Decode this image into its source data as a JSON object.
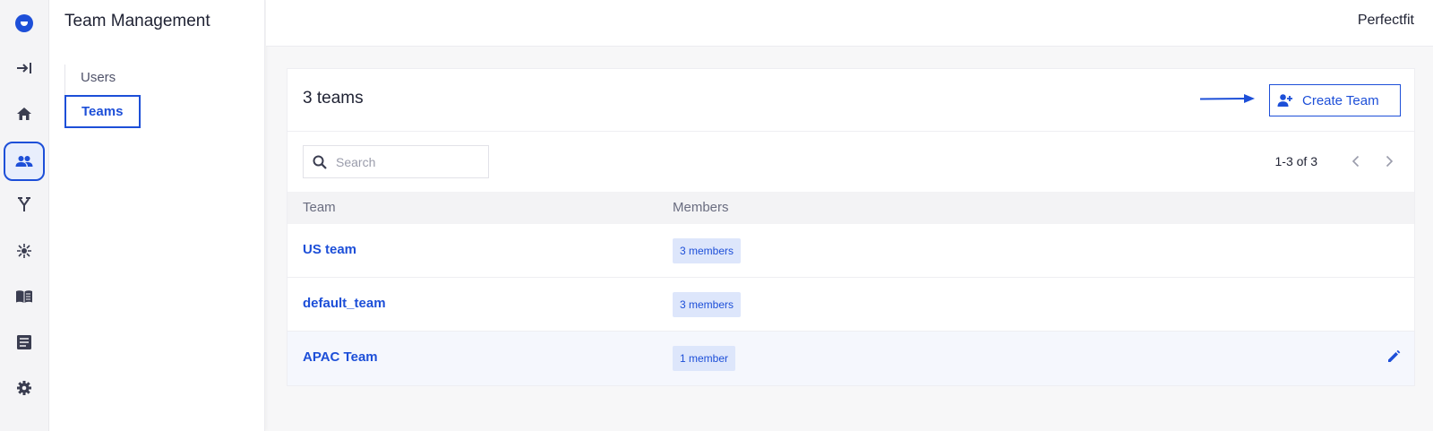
{
  "app": {
    "org_name": "Perfectfit",
    "accent_color": "#1d4fd8"
  },
  "rail": {
    "items": [
      {
        "icon": "logo-icon"
      },
      {
        "icon": "collapse-icon"
      },
      {
        "icon": "home-icon"
      },
      {
        "icon": "team-icon",
        "active": true
      },
      {
        "icon": "branch-icon"
      },
      {
        "icon": "hub-icon"
      },
      {
        "icon": "book-icon"
      },
      {
        "icon": "document-icon"
      },
      {
        "icon": "settings-icon"
      }
    ]
  },
  "subnav": {
    "title": "Team Management",
    "items": [
      {
        "label": "Users"
      },
      {
        "label": "Teams",
        "active": true
      }
    ]
  },
  "main": {
    "team_count": "3 teams",
    "create_button": "Create Team",
    "search": {
      "placeholder": "Search",
      "value": ""
    },
    "pagination": {
      "range": "1-3 of 3"
    },
    "columns": [
      "Team",
      "Members"
    ],
    "rows": [
      {
        "team": "US team",
        "members": "3 members"
      },
      {
        "team": "default_team",
        "members": "3 members"
      },
      {
        "team": "APAC Team",
        "members": "1 member",
        "hovered": true
      }
    ]
  }
}
